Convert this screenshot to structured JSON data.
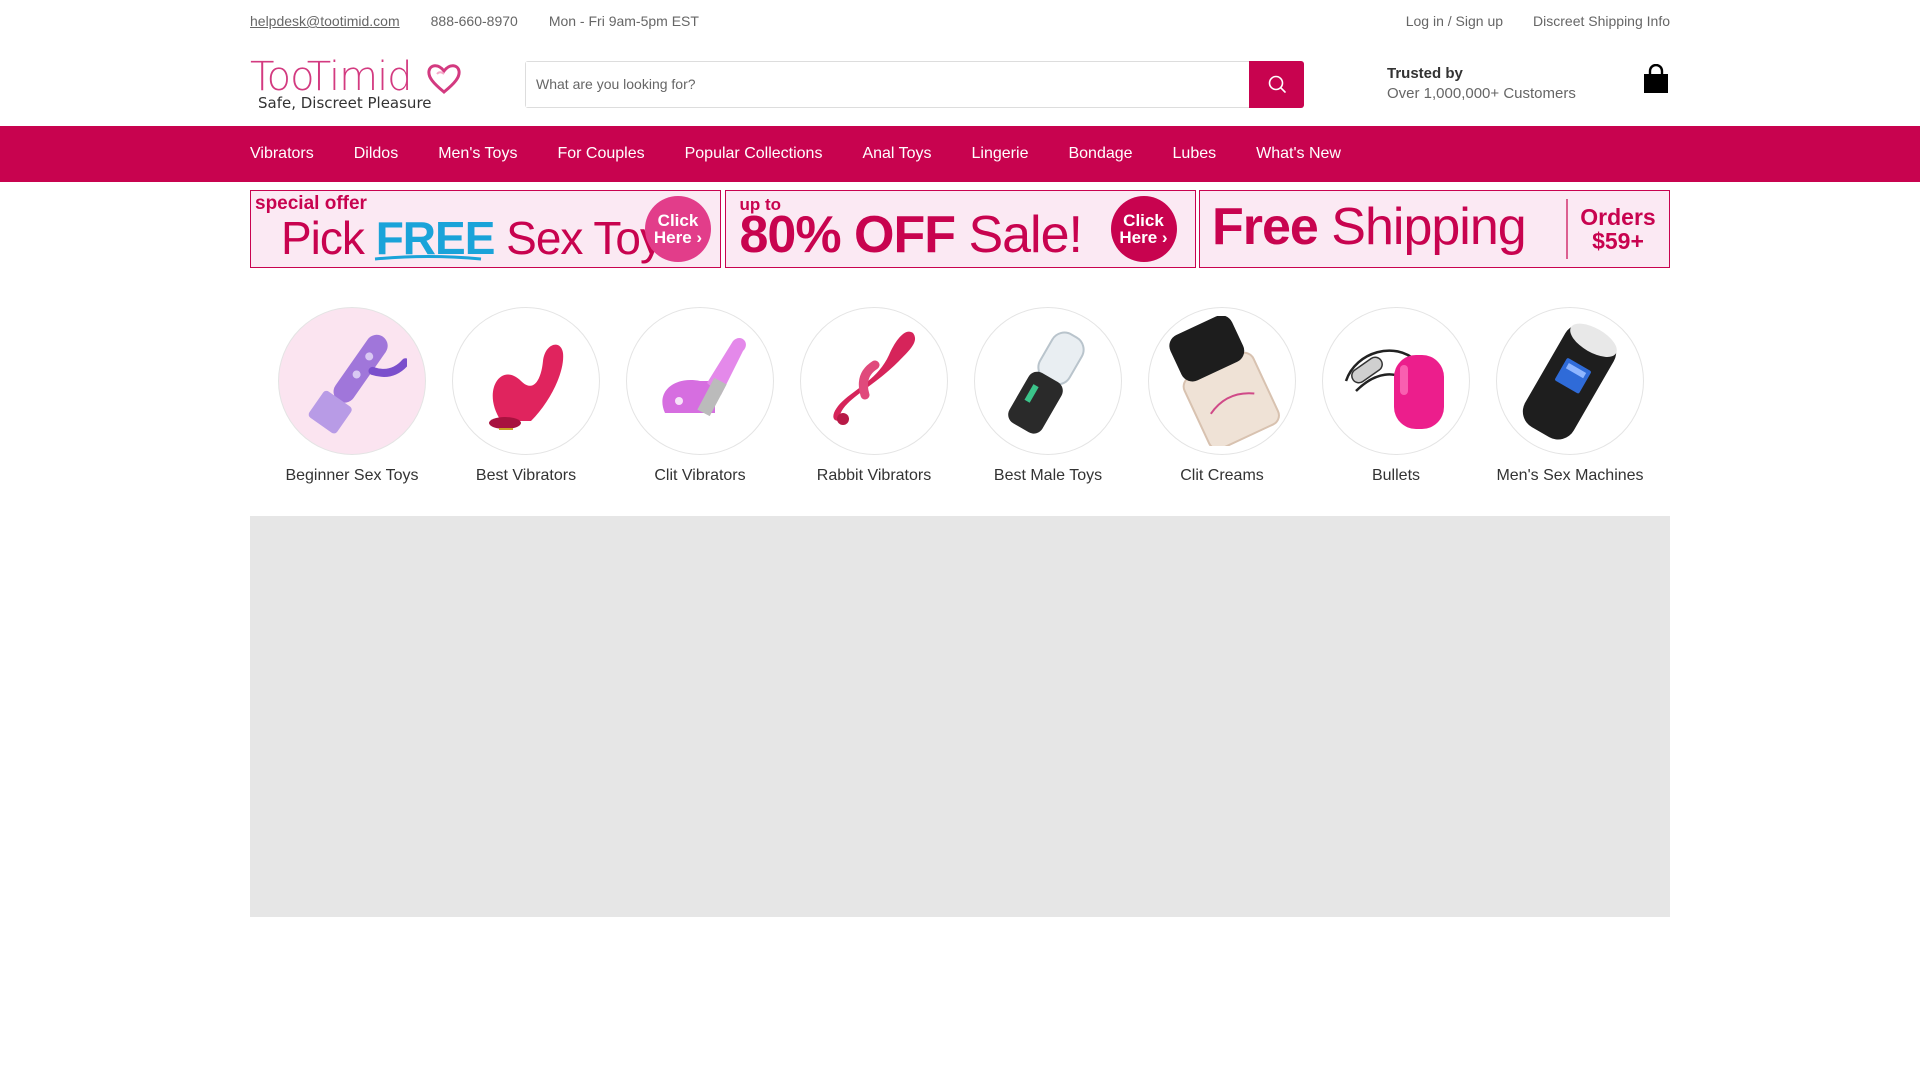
{
  "utility": {
    "email": "helpdesk@tootimid.com",
    "phone": "888-660-8970",
    "hours": "Mon - Fri 9am-5pm EST",
    "login": "Log in / Sign up",
    "shipping_info": "Discreet Shipping Info"
  },
  "header": {
    "logo_text": "TooTimid",
    "logo_tagline": "Safe, Discreet Pleasure",
    "search_placeholder": "What are you looking for?",
    "trust_line1": "Trusted by",
    "trust_line2": "Over 1,000,000+ Customers"
  },
  "nav": [
    "Vibrators",
    "Dildos",
    "Men's Toys",
    "For Couples",
    "Popular Collections",
    "Anal Toys",
    "Lingerie",
    "Bondage",
    "Lubes",
    "What's New"
  ],
  "promos": {
    "p1": {
      "small": "special offer",
      "big_pre": "Pick ",
      "big_free": "FREE",
      "big_post": " Sex Toy",
      "click": "Click Here ›"
    },
    "p2": {
      "small": "up to",
      "big_bold": "80% OFF",
      "big_rest": " Sale!",
      "click": "Click Here ›"
    },
    "p3": {
      "big_bold": "Free",
      "big_rest": " Shipping",
      "orders": "Orders $59+"
    }
  },
  "categories": [
    {
      "label": "Beginner Sex Toys",
      "icon": "purple-rabbit-vibrator-image"
    },
    {
      "label": "Best Vibrators",
      "icon": "pink-suction-vibrator-image"
    },
    {
      "label": "Clit Vibrators",
      "icon": "purple-clit-vibrator-image"
    },
    {
      "label": "Rabbit Vibrators",
      "icon": "pink-rabbit-vibrator-image"
    },
    {
      "label": "Best Male Toys",
      "icon": "male-stroker-image"
    },
    {
      "label": "Clit Creams",
      "icon": "cream-jar-image"
    },
    {
      "label": "Bullets",
      "icon": "pink-bullet-image"
    },
    {
      "label": "Men's Sex Machines",
      "icon": "masturbator-cup-image"
    }
  ],
  "colors": {
    "brand": "#c8034f",
    "brand_light": "#fbe9f3",
    "free_blue": "#1aa3d9",
    "hero_placeholder": "#e6e6e6"
  }
}
